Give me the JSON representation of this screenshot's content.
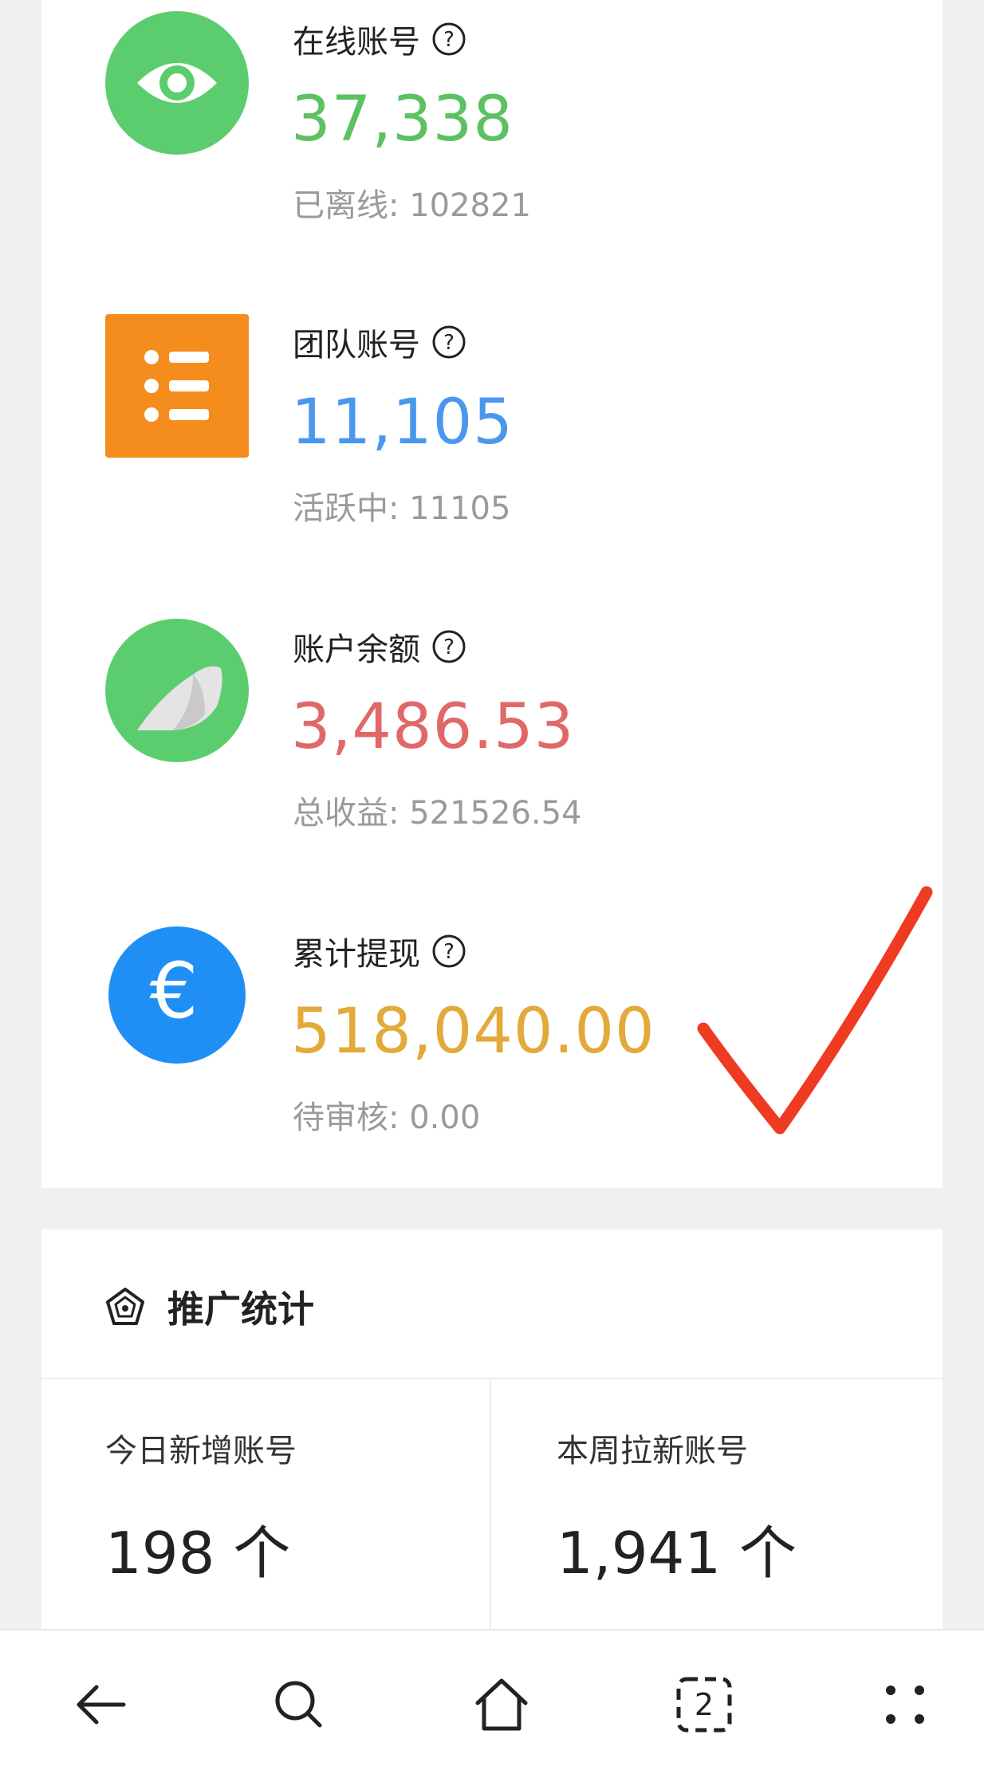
{
  "stats": [
    {
      "id": "online",
      "label": "在线账号",
      "value": "37,338",
      "sub_label": "已离线",
      "sub_value": "102821",
      "color": "#5cc160",
      "icon": "eye-icon"
    },
    {
      "id": "team",
      "label": "团队账号",
      "value": "11,105",
      "sub_label": "活跃中",
      "sub_value": "11105",
      "color": "#4a98ee",
      "icon": "list-icon"
    },
    {
      "id": "balance",
      "label": "账户余额",
      "value": "3,486.53",
      "sub_label": "总收益",
      "sub_value": "521526.54",
      "color": "#e06868",
      "icon": "bird-icon"
    },
    {
      "id": "withdraw",
      "label": "累计提现",
      "value": "518,040.00",
      "sub_label": "待审核",
      "sub_value": "0.00",
      "color": "#e3a93a",
      "icon": "euro-icon"
    }
  ],
  "promo": {
    "title": "推广统计",
    "today": {
      "label": "今日新增账号",
      "value": "198 个"
    },
    "week": {
      "label": "本周拉新账号",
      "value": "1,941 个"
    }
  },
  "nav": {
    "tab_count": "2",
    "icons": [
      "back-arrow-icon",
      "search-icon",
      "home-icon",
      "tabs-icon",
      "more-icon"
    ]
  },
  "colors": {
    "green_icon": "#5ccd6e",
    "orange_icon": "#f48c1e",
    "blue_icon": "#1f8ff5",
    "check_red": "#ef3b22"
  }
}
